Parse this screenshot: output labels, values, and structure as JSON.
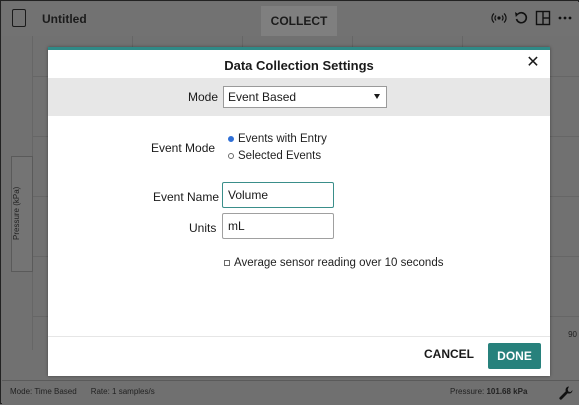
{
  "app": {
    "title": "Untitled",
    "collect_label": "COLLECT",
    "icons": [
      "document-icon",
      "sensor-wireless-icon",
      "undo-icon",
      "layout-icon",
      "more-icon"
    ]
  },
  "graph": {
    "y_axis_label": "Pressure (kPa)",
    "x_axis_partial_tick": "90"
  },
  "status": {
    "mode": "Mode: Time Based",
    "rate": "Rate: 1 samples/s",
    "pressure_label": "Pressure:",
    "pressure_value": "101.68 kPa"
  },
  "modal": {
    "title": "Data Collection Settings",
    "close_glyph": "✕",
    "mode_label": "Mode",
    "mode_value": "Event Based",
    "event_mode_label": "Event Mode",
    "event_mode_options": [
      {
        "label": "Events with Entry",
        "selected": true
      },
      {
        "label": "Selected Events",
        "selected": false
      }
    ],
    "event_name_label": "Event Name",
    "event_name_value": "Volume",
    "units_label": "Units",
    "units_value": "mL",
    "average_label": "Average sensor reading over 10 seconds",
    "average_checked": false,
    "cancel_label": "CANCEL",
    "done_label": "DONE"
  },
  "colors": {
    "accent": "#27817c",
    "radio_selected": "#2f6fd6",
    "overlay": "#6e6e6e"
  }
}
